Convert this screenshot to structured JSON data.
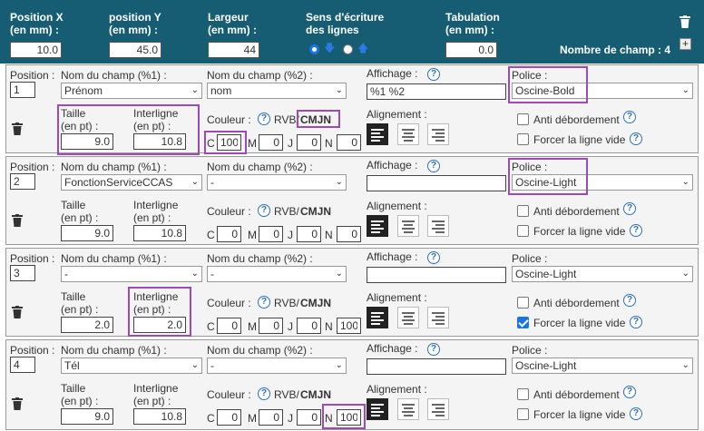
{
  "header": {
    "pos_x_label": "Position X\n(en mm) :",
    "pos_x_value": "10.0",
    "pos_y_label": "position Y\n(en mm) :",
    "pos_y_value": "45.0",
    "largeur_label": "Largeur\n(en mm) :",
    "largeur_value": "44",
    "sens_label": "Sens d'écriture\ndes lignes",
    "tab_label": "Tabulation\n(en mm) :",
    "tab_value": "0.0",
    "nb_champ_label": "Nombre de champ : 4",
    "add_label": "+"
  },
  "labels": {
    "position": "Position :",
    "nom1": "Nom du champ (%1) :",
    "nom2": "Nom du champ (%2) :",
    "affichage": "Affichage :",
    "police": "Police :",
    "taille": "Taille\n(en pt) :",
    "interligne": "Interligne\n(en pt) :",
    "couleur": "Couleur :",
    "rvb": "RVB/",
    "cmjn": "CMJN",
    "alignement": "Alignement :",
    "anti": "Anti débordement",
    "forcer": "Forcer la ligne vide",
    "c": "C",
    "m": "M",
    "j": "J",
    "n": "N"
  },
  "fields": [
    {
      "position": "1",
      "nom1": "Prénom",
      "nom2": "nom",
      "affichage": "%1 %2",
      "police": "Oscine-Bold",
      "taille": "9.0",
      "interligne": "10.8",
      "c": "100",
      "m": "0",
      "j": "0",
      "n": "0",
      "anti": false,
      "forcer": false
    },
    {
      "position": "2",
      "nom1": "FonctionServiceCCAS",
      "nom2": "-",
      "affichage": "",
      "police": "Oscine-Light",
      "taille": "9.0",
      "interligne": "10.8",
      "c": "0",
      "m": "0",
      "j": "0",
      "n": "0",
      "anti": false,
      "forcer": false
    },
    {
      "position": "3",
      "nom1": "-",
      "nom2": "-",
      "affichage": "",
      "police": "Oscine-Light",
      "taille": "2.0",
      "interligne": "2.0",
      "c": "0",
      "m": "0",
      "j": "0",
      "n": "100",
      "anti": false,
      "forcer": true
    },
    {
      "position": "4",
      "nom1": "Tél",
      "nom2": "-",
      "affichage": "",
      "police": "Oscine-Light",
      "taille": "9.0",
      "interligne": "10.8",
      "c": "0",
      "m": "0",
      "j": "0",
      "n": "100",
      "anti": false,
      "forcer": false
    }
  ],
  "colors": {
    "header_bg": "#165d74",
    "highlight": "#9b4bb2",
    "accent": "#1a73e8"
  }
}
